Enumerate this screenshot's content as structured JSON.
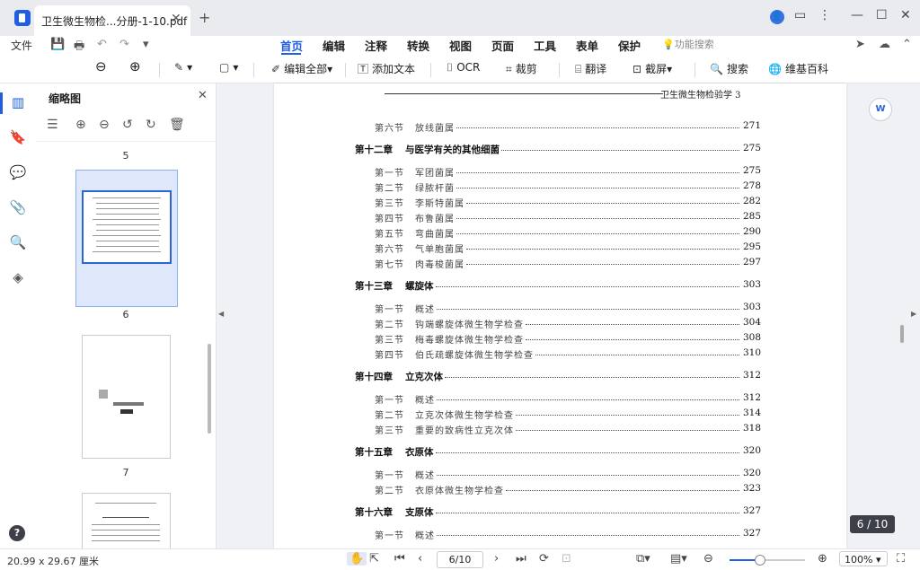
{
  "tab": {
    "title": "卫生微生物检...分册-1-10.pdf"
  },
  "menu": {
    "file": "文件",
    "tabs": [
      "首页",
      "编辑",
      "注释",
      "转换",
      "视图",
      "页面",
      "工具",
      "表单",
      "保护"
    ],
    "active": "首页",
    "feature_search": "功能搜索"
  },
  "toolbar": {
    "edit_all": "编辑全部",
    "add_text": "添加文本",
    "ocr": "OCR",
    "crop": "裁剪",
    "translate": "翻译",
    "screenshot": "截屏",
    "search": "搜索",
    "wiki": "维基百科"
  },
  "panel": {
    "title": "缩略图",
    "pages": [
      "5",
      "6",
      "7"
    ]
  },
  "doc": {
    "header": "卫生微生物检验学    3",
    "toc": [
      {
        "kind": "sec",
        "label": "第六节",
        "title": "放线菌属",
        "page": "271"
      },
      {
        "kind": "chap",
        "label": "第十二章",
        "title": "与医学有关的其他细菌",
        "page": "275"
      },
      {
        "kind": "sec",
        "label": "第一节",
        "title": "军团菌属",
        "page": "275"
      },
      {
        "kind": "sec",
        "label": "第二节",
        "title": "绿脓杆菌",
        "page": "278"
      },
      {
        "kind": "sec",
        "label": "第三节",
        "title": "李斯特菌属",
        "page": "282"
      },
      {
        "kind": "sec",
        "label": "第四节",
        "title": "布鲁菌属",
        "page": "285"
      },
      {
        "kind": "sec",
        "label": "第五节",
        "title": "弯曲菌属",
        "page": "290"
      },
      {
        "kind": "sec",
        "label": "第六节",
        "title": "气单胞菌属",
        "page": "295"
      },
      {
        "kind": "sec",
        "label": "第七节",
        "title": "肉毒梭菌属",
        "page": "297"
      },
      {
        "kind": "chap",
        "label": "第十三章",
        "title": "螺旋体",
        "page": "303"
      },
      {
        "kind": "sec",
        "label": "第一节",
        "title": "概述",
        "page": "303"
      },
      {
        "kind": "sec",
        "label": "第二节",
        "title": "钩端螺旋体微生物学检查",
        "page": "304"
      },
      {
        "kind": "sec",
        "label": "第三节",
        "title": "梅毒螺旋体微生物学检查",
        "page": "308"
      },
      {
        "kind": "sec",
        "label": "第四节",
        "title": "伯氏疏螺旋体微生物学检查",
        "page": "310"
      },
      {
        "kind": "chap",
        "label": "第十四章",
        "title": "立克次体",
        "page": "312"
      },
      {
        "kind": "sec",
        "label": "第一节",
        "title": "概述",
        "page": "312"
      },
      {
        "kind": "sec",
        "label": "第二节",
        "title": "立克次体微生物学检查",
        "page": "314"
      },
      {
        "kind": "sec",
        "label": "第三节",
        "title": "重要的致病性立克次体",
        "page": "318"
      },
      {
        "kind": "chap",
        "label": "第十五章",
        "title": "衣原体",
        "page": "320"
      },
      {
        "kind": "sec",
        "label": "第一节",
        "title": "概述",
        "page": "320"
      },
      {
        "kind": "sec",
        "label": "第二节",
        "title": "衣原体微生物学检查",
        "page": "323"
      },
      {
        "kind": "chap",
        "label": "第十六章",
        "title": "支原体",
        "page": "327"
      },
      {
        "kind": "sec",
        "label": "第一节",
        "title": "概述",
        "page": "327"
      }
    ]
  },
  "status": {
    "dimensions": "20.99 x 29.67 厘米",
    "page_input": "6/10",
    "badge": "6 / 10",
    "zoom": "100%"
  },
  "colors": {
    "accent": "#1f5fe0"
  }
}
